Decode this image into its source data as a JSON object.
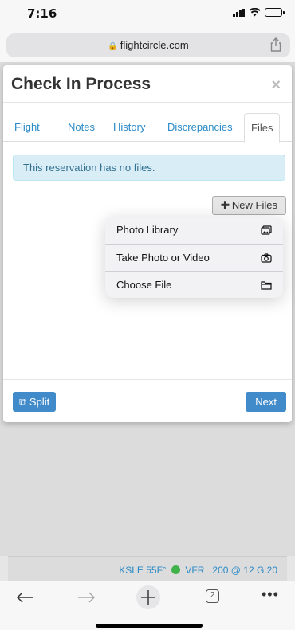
{
  "status": {
    "time": "7:16"
  },
  "browser": {
    "url": "flightcircle.com",
    "tab_count": "2"
  },
  "modal": {
    "title": "Check In Process",
    "close": "×",
    "tabs": [
      "Flight",
      "Notes",
      "History",
      "Discrepancies",
      "Files"
    ],
    "active_tab": "Files",
    "alert": "This reservation has no files.",
    "new_files_label": "New Files",
    "split_label": "Split",
    "next_label": "Next"
  },
  "file_menu": {
    "items": [
      {
        "label": "Photo Library",
        "icon": "photo-library-icon"
      },
      {
        "label": "Take Photo or Video",
        "icon": "camera-icon"
      },
      {
        "label": "Choose File",
        "icon": "folder-icon"
      }
    ]
  },
  "weather": {
    "station": "KSLE 55F°",
    "condition": "VFR",
    "wind": "200 @ 12 G 20"
  },
  "colors": {
    "link": "#2a8ac6",
    "primary_button": "#428bca",
    "alert_bg": "#d9edf7",
    "vfr": "#3fb24a"
  }
}
